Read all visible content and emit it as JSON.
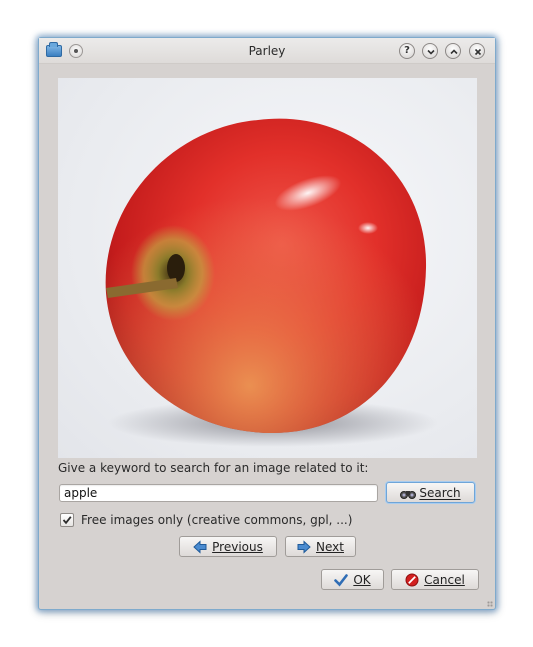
{
  "window": {
    "title": "Parley",
    "controls": [
      "help-icon",
      "minimize-icon",
      "maximize-icon",
      "close-icon"
    ]
  },
  "image": {
    "subject": "apple",
    "icon": "photo-preview"
  },
  "search": {
    "prompt": "Give a keyword to search for an image related to it:",
    "value": "apple",
    "button_label": "Search",
    "button_icon": "binoculars-icon"
  },
  "options": {
    "free_images_label": "Free images only (creative commons, gpl, ...)",
    "free_images_checked": true
  },
  "navigation": {
    "previous_label": "Previous",
    "next_label": "Next"
  },
  "dialog": {
    "ok_label": "OK",
    "cancel_label": "Cancel"
  },
  "colors": {
    "accent": "#6fa5d8",
    "window_bg": "#d6d2d0",
    "arrow_blue": "#3b7fc4",
    "cancel_red": "#d21f1f"
  }
}
